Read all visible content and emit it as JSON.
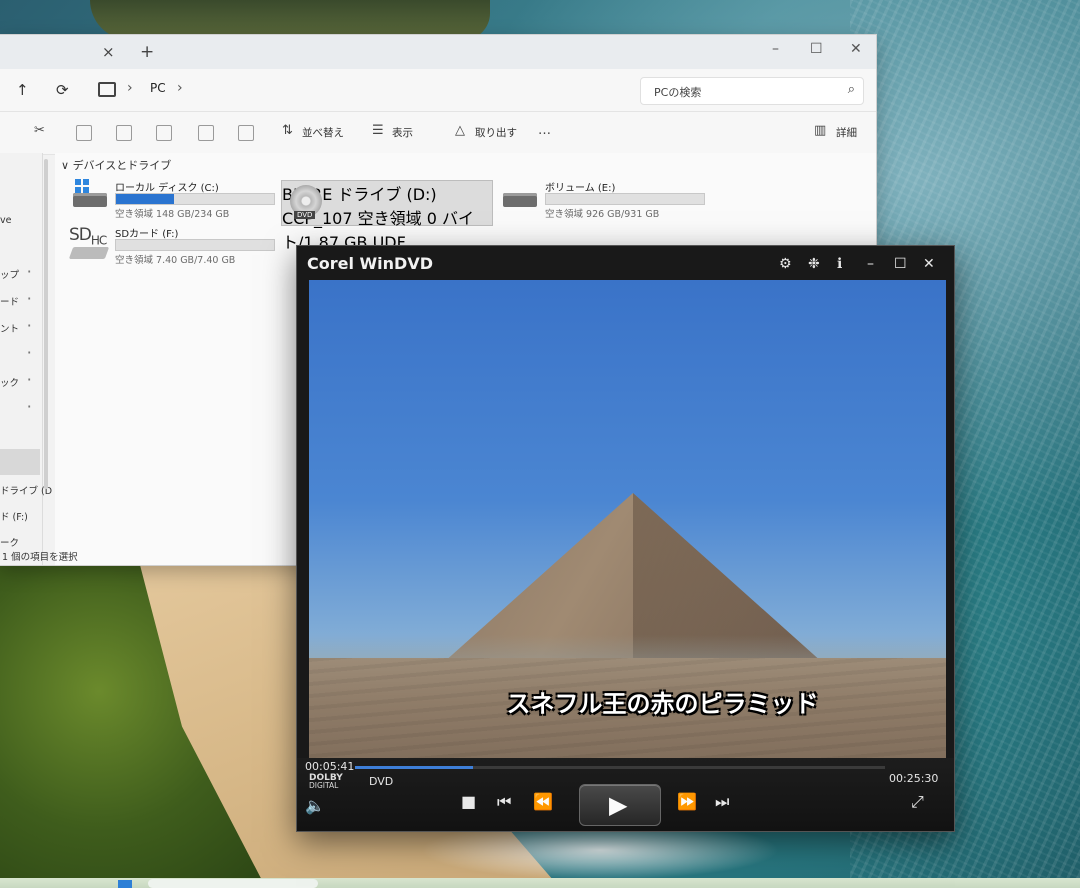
{
  "explorer": {
    "tab_close": "×",
    "tab_new": "+",
    "window_controls": [
      "–",
      "☐",
      "✕"
    ],
    "nav_up": "↑",
    "nav_refresh": "⟳",
    "breadcrumb": "PC",
    "crumb_sep": "›",
    "search_placeholder": "PCの検索",
    "commands": {
      "sort": "並べ替え",
      "view": "表示",
      "eject": "取り出す",
      "more": "…",
      "details": "詳細"
    },
    "group_header": "デバイスとドライブ",
    "drives": [
      {
        "name": "ローカル ディスク (C:)",
        "free": "空き領域 148 GB/234 GB",
        "used_fraction": 0.37
      },
      {
        "name": "BD-RE ドライブ (D:) CCP_107",
        "free": "空き領域 0 バイト/1.87 GB",
        "fs": "UDF",
        "selected": true,
        "tag": "DVD"
      },
      {
        "name": "ボリューム (E:)",
        "free": "空き領域 926 GB/931 GB",
        "used_fraction": 0.0
      },
      {
        "name": "SDカード (F:)",
        "free": "空き領域 7.40 GB/7.40 GB",
        "used_fraction": 0.0,
        "tag": "SDHC"
      }
    ],
    "nav_items": [
      "ve",
      "ップ",
      "ード",
      "ント",
      "",
      "ック",
      "",
      "ドライブ (D",
      "ド (F:)",
      "ーク"
    ],
    "status": "1 個の項目を選択"
  },
  "player": {
    "title": "Corel WinDVD",
    "controls_icons": [
      "⚙",
      "❉",
      "ℹ",
      "–",
      "☐",
      "✕"
    ],
    "subtitle": "スネフル王の赤のピラミッド",
    "elapsed": "00:05:41",
    "total": "00:25:30",
    "progress_fraction": 0.223,
    "audio_logo_line1": "DOLBY",
    "audio_logo_line2": "DIGITAL",
    "format": "DVD",
    "buttons": {
      "volume": "🔈",
      "stop": "■",
      "prev": "⏮",
      "rewind": "⏪",
      "play": "▶",
      "forward": "⏩",
      "next": "⏭",
      "fullscreen": "⤢"
    }
  },
  "colors": {
    "accent": "#2a74d0",
    "player_bg": "#191919",
    "progress": "#3e7fd8"
  }
}
